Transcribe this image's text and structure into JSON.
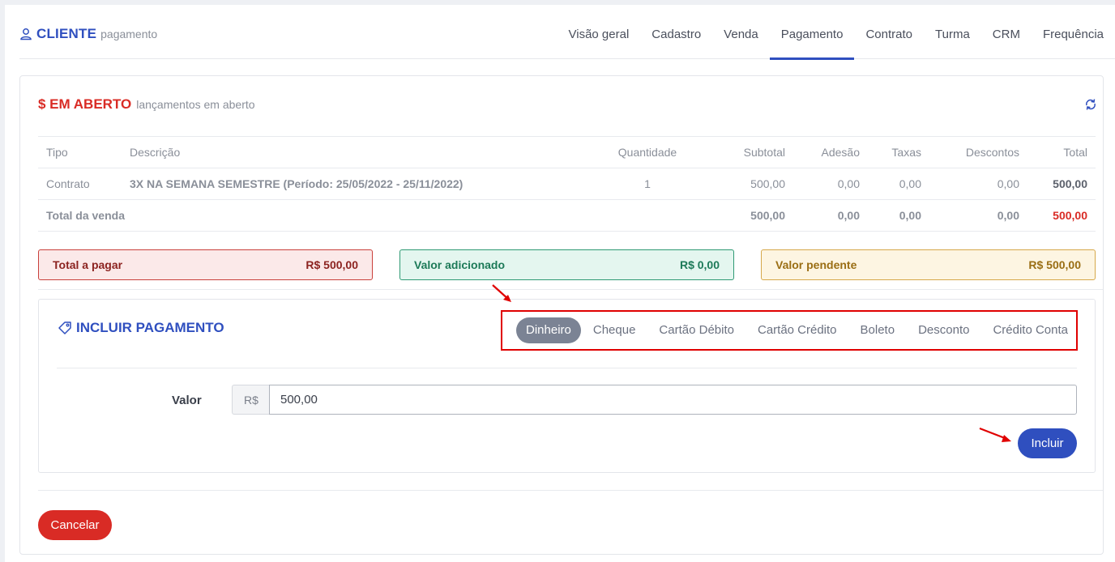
{
  "header": {
    "title": "CLIENTE",
    "subtitle": "pagamento",
    "tabs": [
      {
        "label": "Visão geral"
      },
      {
        "label": "Cadastro"
      },
      {
        "label": "Venda"
      },
      {
        "label": "Pagamento",
        "active": true
      },
      {
        "label": "Contrato"
      },
      {
        "label": "Turma"
      },
      {
        "label": "CRM"
      },
      {
        "label": "Frequência"
      }
    ]
  },
  "open_section": {
    "title": "$ EM ABERTO",
    "subtitle": "lançamentos em aberto",
    "columns": [
      "Tipo",
      "Descrição",
      "Quantidade",
      "Subtotal",
      "Adesão",
      "Taxas",
      "Descontos",
      "Total"
    ],
    "rows": [
      {
        "tipo": "Contrato",
        "descricao": "3X NA SEMANA SEMESTRE (Período: 25/05/2022 - 25/11/2022)",
        "quantidade": "1",
        "subtotal": "500,00",
        "adesao": "0,00",
        "taxas": "0,00",
        "descontos": "0,00",
        "total": "500,00"
      }
    ],
    "totals": {
      "label": "Total da venda",
      "subtotal": "500,00",
      "adesao": "0,00",
      "taxas": "0,00",
      "descontos": "0,00",
      "total": "500,00"
    }
  },
  "summary": {
    "total_a_pagar": {
      "label": "Total a pagar",
      "value": "R$ 500,00"
    },
    "valor_adicionado": {
      "label": "Valor adicionado",
      "value": "R$ 0,00"
    },
    "valor_pendente": {
      "label": "Valor pendente",
      "value": "R$ 500,00"
    }
  },
  "payment": {
    "title": "INCLUIR PAGAMENTO",
    "methods": [
      "Dinheiro",
      "Cheque",
      "Cartão Débito",
      "Cartão Crédito",
      "Boleto",
      "Desconto",
      "Crédito Conta"
    ],
    "active_method": "Dinheiro",
    "valor_label": "Valor",
    "currency_prefix": "R$",
    "valor": "500,00",
    "incluir_label": "Incluir"
  },
  "cancel_label": "Cancelar",
  "colors": {
    "primary": "#2f4fbf",
    "danger": "#d92b25",
    "annotation": "#e00000"
  }
}
